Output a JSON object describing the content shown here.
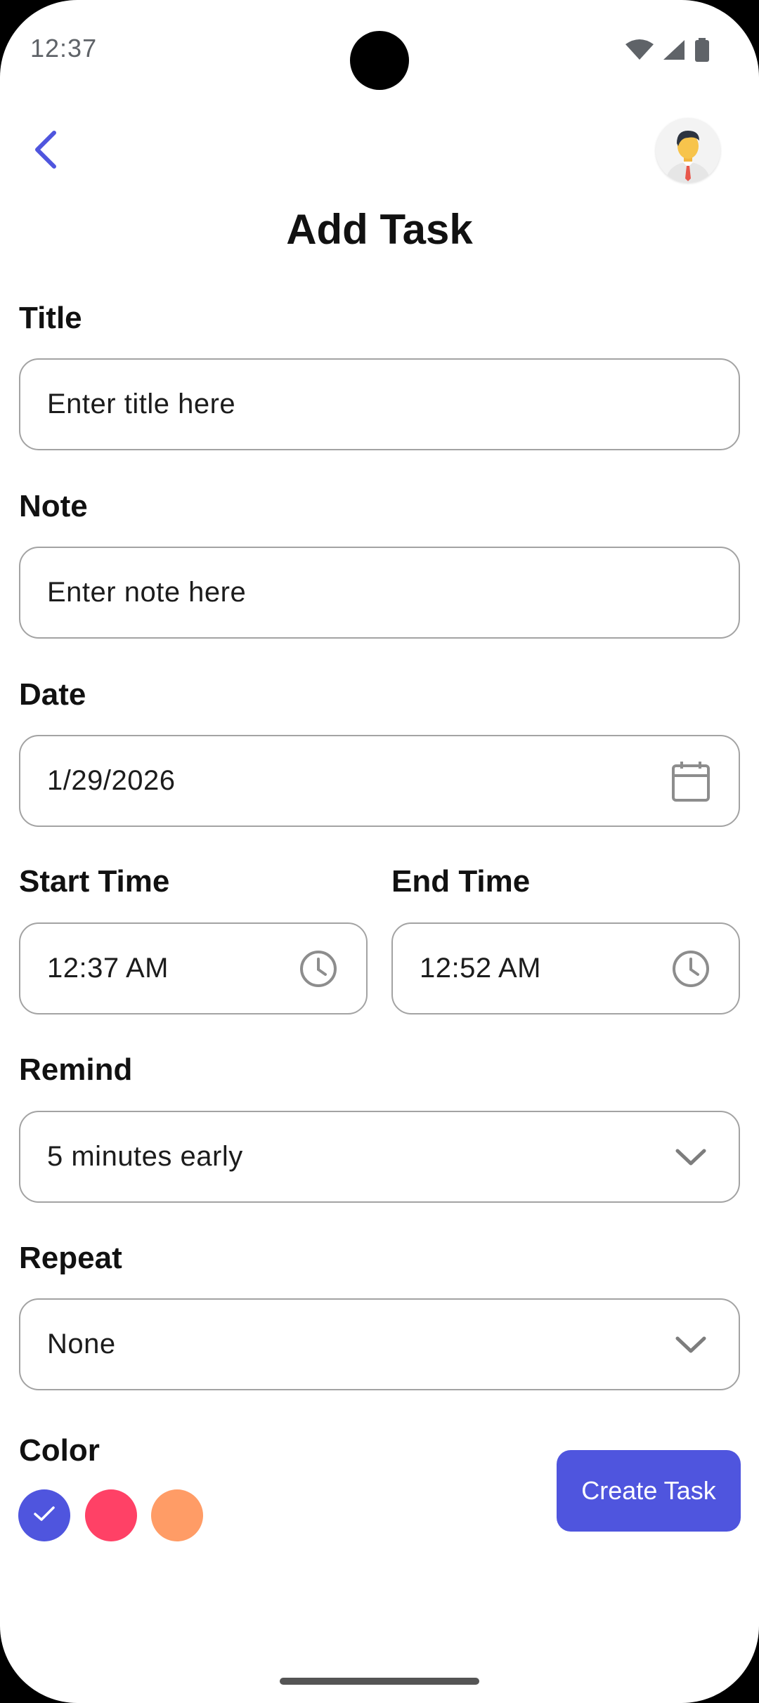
{
  "status_bar": {
    "time": "12:37",
    "icons": [
      "wifi-icon",
      "signal-icon",
      "battery-icon"
    ]
  },
  "app_bar": {
    "back_icon": "chevron-left-icon",
    "avatar": "user-avatar"
  },
  "page": {
    "title": "Add Task"
  },
  "form": {
    "title": {
      "label": "Title",
      "placeholder": "Enter title here"
    },
    "note": {
      "label": "Note",
      "placeholder": "Enter note here"
    },
    "date": {
      "label": "Date",
      "value": "1/29/2026",
      "icon": "calendar-icon"
    },
    "start_time": {
      "label": "Start Time",
      "value": "12:37 AM",
      "icon": "clock-icon"
    },
    "end_time": {
      "label": "End Time",
      "value": "12:52 AM",
      "icon": "clock-icon"
    },
    "remind": {
      "label": "Remind",
      "value": "5 minutes early",
      "icon": "chevron-down-icon"
    },
    "repeat": {
      "label": "Repeat",
      "value": "None",
      "icon": "chevron-down-icon"
    }
  },
  "color": {
    "label": "Color",
    "options": [
      {
        "name": "blue",
        "hex": "#4f55de",
        "selected": true
      },
      {
        "name": "pink",
        "hex": "#ff4166",
        "selected": false
      },
      {
        "name": "orange",
        "hex": "#ff9c66",
        "selected": false
      }
    ]
  },
  "actions": {
    "create_label": "Create Task",
    "create_color": "#4f55de"
  },
  "theme": {
    "accent": "#4f55de",
    "border": "#a3a3a3",
    "icon_gray": "#8d8d8d"
  }
}
